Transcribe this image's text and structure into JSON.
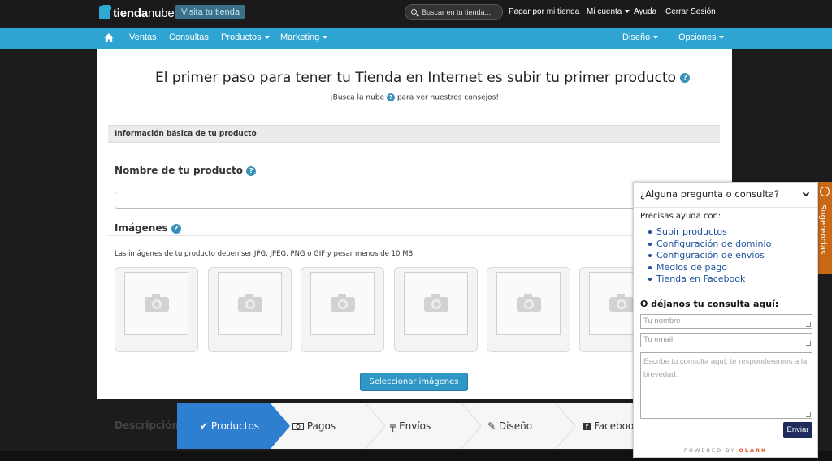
{
  "topbar": {
    "logo_left": "tienda",
    "logo_right": "nube",
    "visit_store": "Visita tu tienda",
    "search_placeholder": "Buscar en tu tienda...",
    "links": {
      "pay": "Pagar por mi tienda",
      "account": "Mi cuenta",
      "help": "Ayuda",
      "logout": "Cerrar Sesión"
    }
  },
  "nav": {
    "items": [
      "Ventas",
      "Consultas",
      "Productos",
      "Marketing"
    ],
    "right": [
      "Diseño",
      "Opciones"
    ]
  },
  "main": {
    "heading": "El primer paso para tener tu Tienda en Internet es subir tu primer producto",
    "subtitle_before": "¡Busca la nube",
    "subtitle_after": "para ver nuestros consejos!",
    "section_title": "Información básica de tu producto",
    "product_name_label": "Nombre de tu producto",
    "images_label": "Imágenes",
    "images_note": "Las imágenes de tu producto deben ser JPG, JPEG, PNG o GIF y pesar menos de 10 MB.",
    "select_images": "Seleccionar imágenes",
    "description_label": "Descripción"
  },
  "steps": [
    {
      "label": "Productos",
      "icon": "check-icon",
      "active": true
    },
    {
      "label": "Pagos",
      "icon": "money-icon",
      "active": false
    },
    {
      "label": "Envíos",
      "icon": "signpost-icon",
      "active": false
    },
    {
      "label": "Diseño",
      "icon": "pencil-icon",
      "active": false
    },
    {
      "label": "Facebook",
      "icon": "facebook-icon",
      "active": false
    }
  ],
  "chat": {
    "title": "¿Alguna pregunta o consulta?",
    "need_help": "Precisas ayuda con:",
    "links": [
      "Subir productos",
      "Configuración de dominio",
      "Configuración de envíos",
      "Medios de pago",
      "Tienda en Facebook"
    ],
    "leave_message": "O déjanos tu consulta aquí:",
    "name_placeholder": "Tu nombre",
    "email_placeholder": "Tu email",
    "message_placeholder": "Escribe tu consulta aquí, te responderemos a la brevedad.",
    "send": "Enviar",
    "powered_by": "POWERED BY",
    "powered_brand": "OLARK"
  },
  "feedback_tab": "Sugerencias",
  "colors": {
    "accent": "#2ea4d2",
    "active_step": "#2f7fd0",
    "chat_button": "#1e2b5c",
    "feedback": "#c96817"
  }
}
